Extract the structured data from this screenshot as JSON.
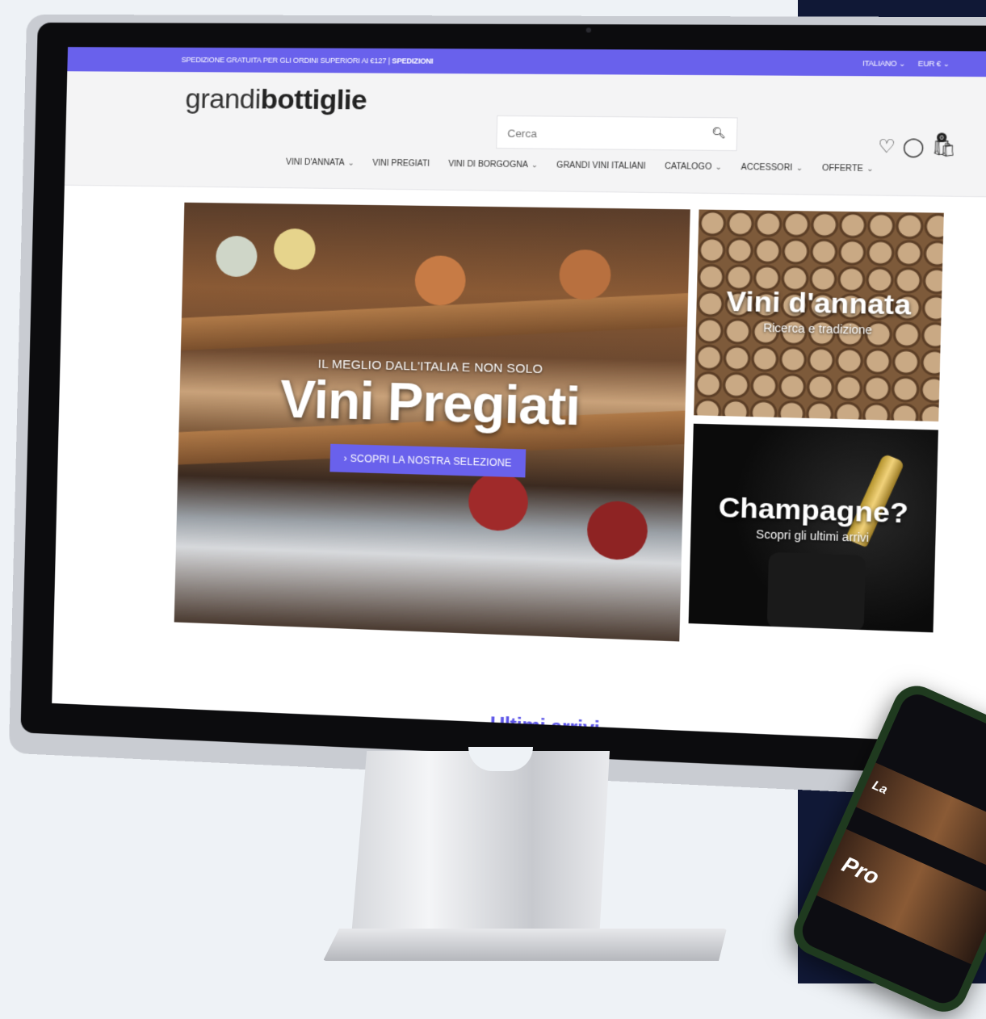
{
  "promo": {
    "text": "SPEDIZIONE GRATUITA PER GLI ORDINI SUPERIORI AI €127 | ",
    "link": "SPEDIZIONI",
    "language": "Italiano ⌄",
    "currency": "EUR € ⌄"
  },
  "logo": {
    "light": "grandi",
    "bold": "bottiglie"
  },
  "search": {
    "placeholder": "Cerca"
  },
  "cart": {
    "count": "0"
  },
  "nav": [
    {
      "label": "VINI D'ANNATA",
      "dropdown": true
    },
    {
      "label": "VINI PREGIATI",
      "dropdown": false
    },
    {
      "label": "VINI DI BORGOGNA",
      "dropdown": true
    },
    {
      "label": "GRANDI VINI ITALIANI",
      "dropdown": false
    },
    {
      "label": "CATALOGO",
      "dropdown": true
    },
    {
      "label": "ACCESSORI",
      "dropdown": true
    },
    {
      "label": "OFFERTE",
      "dropdown": true
    }
  ],
  "hero": {
    "subtitle": "IL MEGLIO DALL'ITALIA E NON SOLO",
    "title": "Vini Pregiati",
    "button": "› SCOPRI LA NOSTRA SELEZIONE"
  },
  "tiles": {
    "annata": {
      "title": "Vini d'annata",
      "subtitle": "Ricerca e tradizione"
    },
    "champagne": {
      "title": "Champagne?",
      "subtitle": "Scopri gli ultimi arrivi"
    }
  },
  "section": {
    "title": "Ultimi arrivi"
  },
  "phone": {
    "line1": "Pro",
    "line2": "La"
  },
  "colors": {
    "accent": "#6961ec",
    "dark_bg": "#101836"
  }
}
